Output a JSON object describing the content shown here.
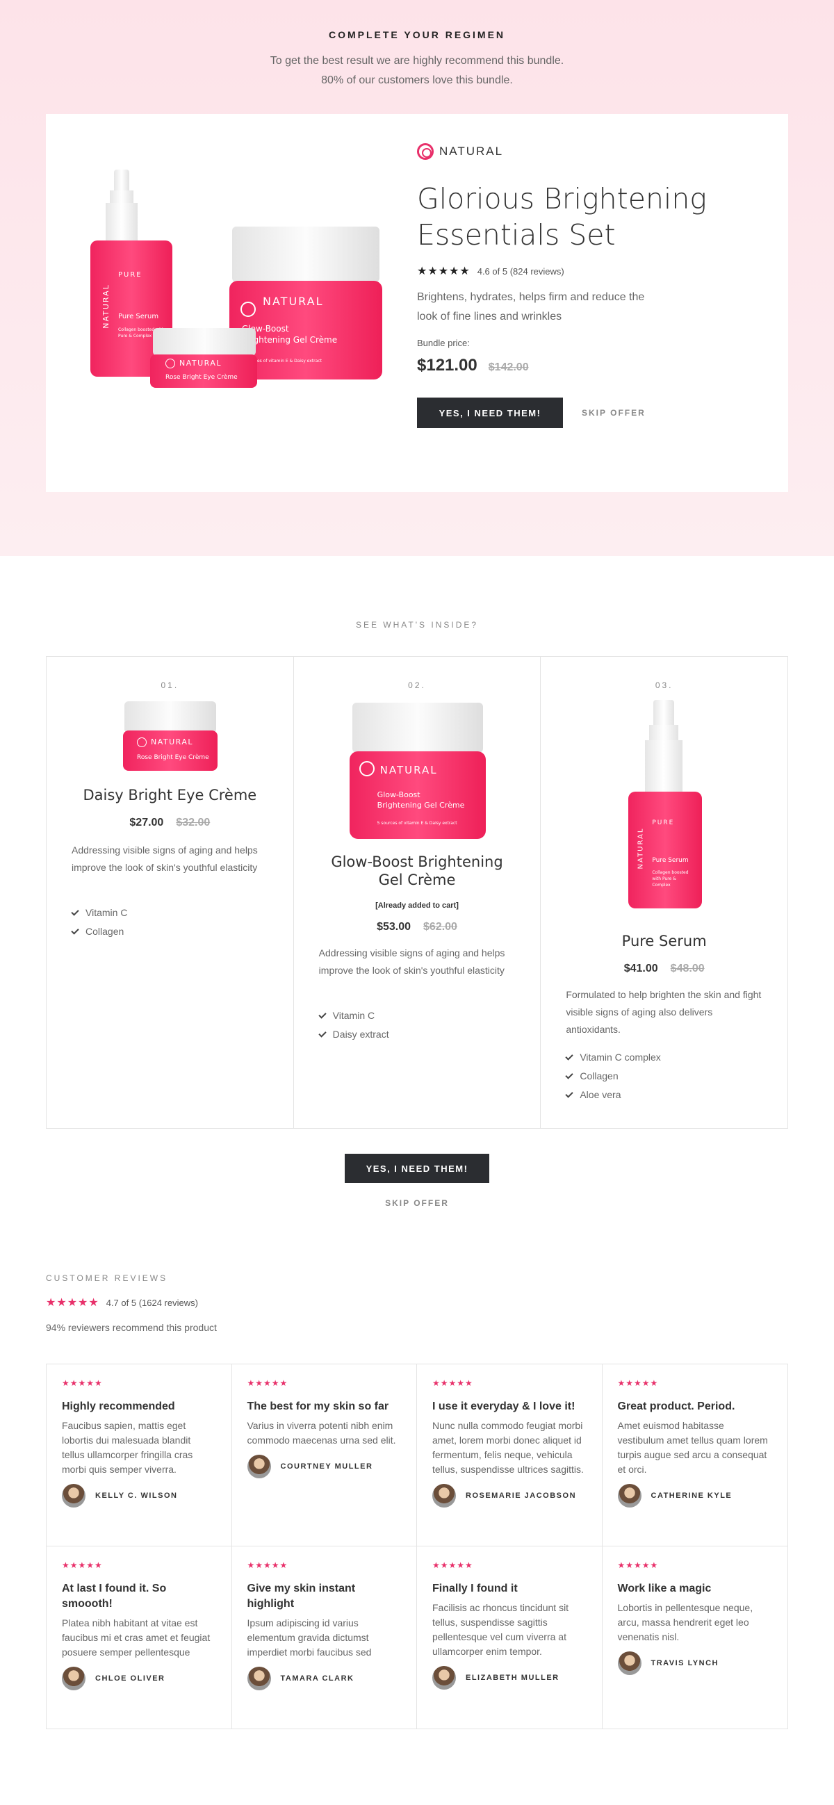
{
  "hero": {
    "eyebrow": "COMPLETE YOUR REGIMEN",
    "subtitle_line1": "To get the best result we are highly recommend this bundle.",
    "subtitle_line2": "80% of our customers love this bundle.",
    "brand": "NATURAL",
    "title_line1": "Glorious Brightening",
    "title_line2": "Essentials Set",
    "stars": "★★★★★",
    "rating_text": "4.6 of 5 (824 reviews)",
    "description_line1": "Brightens, hydrates, helps firm and reduce the",
    "description_line2": "look of fine lines and wrinkles",
    "price_label": "Bundle price:",
    "price": "$121.00",
    "old_price": "$142.00",
    "cta": "YES, I NEED THEM!",
    "skip": "SKIP OFFER"
  },
  "product_art": {
    "pure": "PURE",
    "natural_vertical": "NATURAL",
    "serum_name": "Pure Serum",
    "serum_small": "Collagen boosted with Pure & Complex",
    "eye_brand": "NATURAL",
    "eye_name": "Rose Bright Eye Crème",
    "jar_brand": "NATURAL",
    "jar_name_line1": "Glow-Boost",
    "jar_name_line2": "Brightening Gel Crème",
    "jar_small": "5 sources of vitamin E & Daisy extract"
  },
  "inside": {
    "heading": "SEE WHAT'S INSIDE?",
    "products": [
      {
        "num": "01.",
        "name": "Daisy Bright Eye Crème",
        "price": "$27.00",
        "old": "$32.00",
        "desc": "Addressing visible signs of aging and helps improve the look of skin's youthful elasticity",
        "features": [
          "Vitamin C",
          "Collagen"
        ]
      },
      {
        "num": "02.",
        "name_line1": "Glow-Boost Brightening",
        "name_line2": "Gel Crème",
        "added": "[Already added to cart]",
        "price": "$53.00",
        "old": "$62.00",
        "desc": "Addressing visible signs of aging and helps improve the look of skin's youthful elasticity",
        "features": [
          "Vitamin C",
          "Daisy extract"
        ]
      },
      {
        "num": "03.",
        "name": "Pure Serum",
        "price": "$41.00",
        "old": "$48.00",
        "desc": "Formulated to help brighten the skin and fight visible signs of aging also delivers antioxidants.",
        "features": [
          "Vitamin C complex",
          "Collagen",
          "Aloe vera"
        ]
      }
    ],
    "cta": "YES, I NEED THEM!",
    "skip": "SKIP OFFER"
  },
  "reviews": {
    "heading": "CUSTOMER REVIEWS",
    "stars": "★★★★★",
    "rating_text": "4.7 of 5 (1624 reviews)",
    "recommend": "94% reviewers recommend this product",
    "items": [
      {
        "stars": "★★★★★",
        "title": "Highly recommended",
        "text": "Faucibus sapien, mattis eget lobortis dui malesuada blandit tellus ullamcorper fringilla cras morbi quis semper viverra.",
        "author": "KELLY C. WILSON"
      },
      {
        "stars": "★★★★★",
        "title": "The best for my skin so far",
        "text": "Varius in viverra potenti nibh enim commodo maecenas urna sed elit.",
        "author": "COURTNEY MULLER"
      },
      {
        "stars": "★★★★★",
        "title": "I use it everyday & I love it!",
        "text": "Nunc nulla commodo feugiat morbi amet, lorem morbi donec aliquet id fermentum, felis neque, vehicula tellus, suspendisse ultrices sagittis.",
        "author": "ROSEMARIE JACOBSON"
      },
      {
        "stars": "★★★★★",
        "title": "Great product. Period.",
        "text": "Amet euismod habitasse vestibulum amet tellus quam lorem turpis augue sed arcu a consequat et orci.",
        "author": "CATHERINE KYLE"
      },
      {
        "stars": "★★★★★",
        "title": "At last I found it. So smoooth!",
        "text": "Platea nibh habitant at vitae est faucibus mi et cras amet et feugiat posuere semper pellentesque",
        "author": "CHLOE OLIVER"
      },
      {
        "stars": "★★★★★",
        "title": "Give my skin instant highlight",
        "text": "Ipsum adipiscing id varius elementum gravida dictumst imperdiet morbi faucibus sed",
        "author": "TAMARA CLARK"
      },
      {
        "stars": "★★★★★",
        "title": "Finally I found it",
        "text": "Facilisis ac rhoncus tincidunt sit tellus, suspendisse sagittis pellentesque vel cum viverra at ullamcorper enim tempor.",
        "author": "ELIZABETH MULLER"
      },
      {
        "stars": "★★★★★",
        "title": "Work like a magic",
        "text": "Lobortis in pellentesque neque, arcu, massa hendrerit eget leo venenatis nisl.",
        "author": "TRAVIS LYNCH"
      }
    ]
  },
  "colors": {
    "accent": "#e8306a",
    "button": "#2b2d31",
    "hero_bg": "#fde3e9"
  }
}
